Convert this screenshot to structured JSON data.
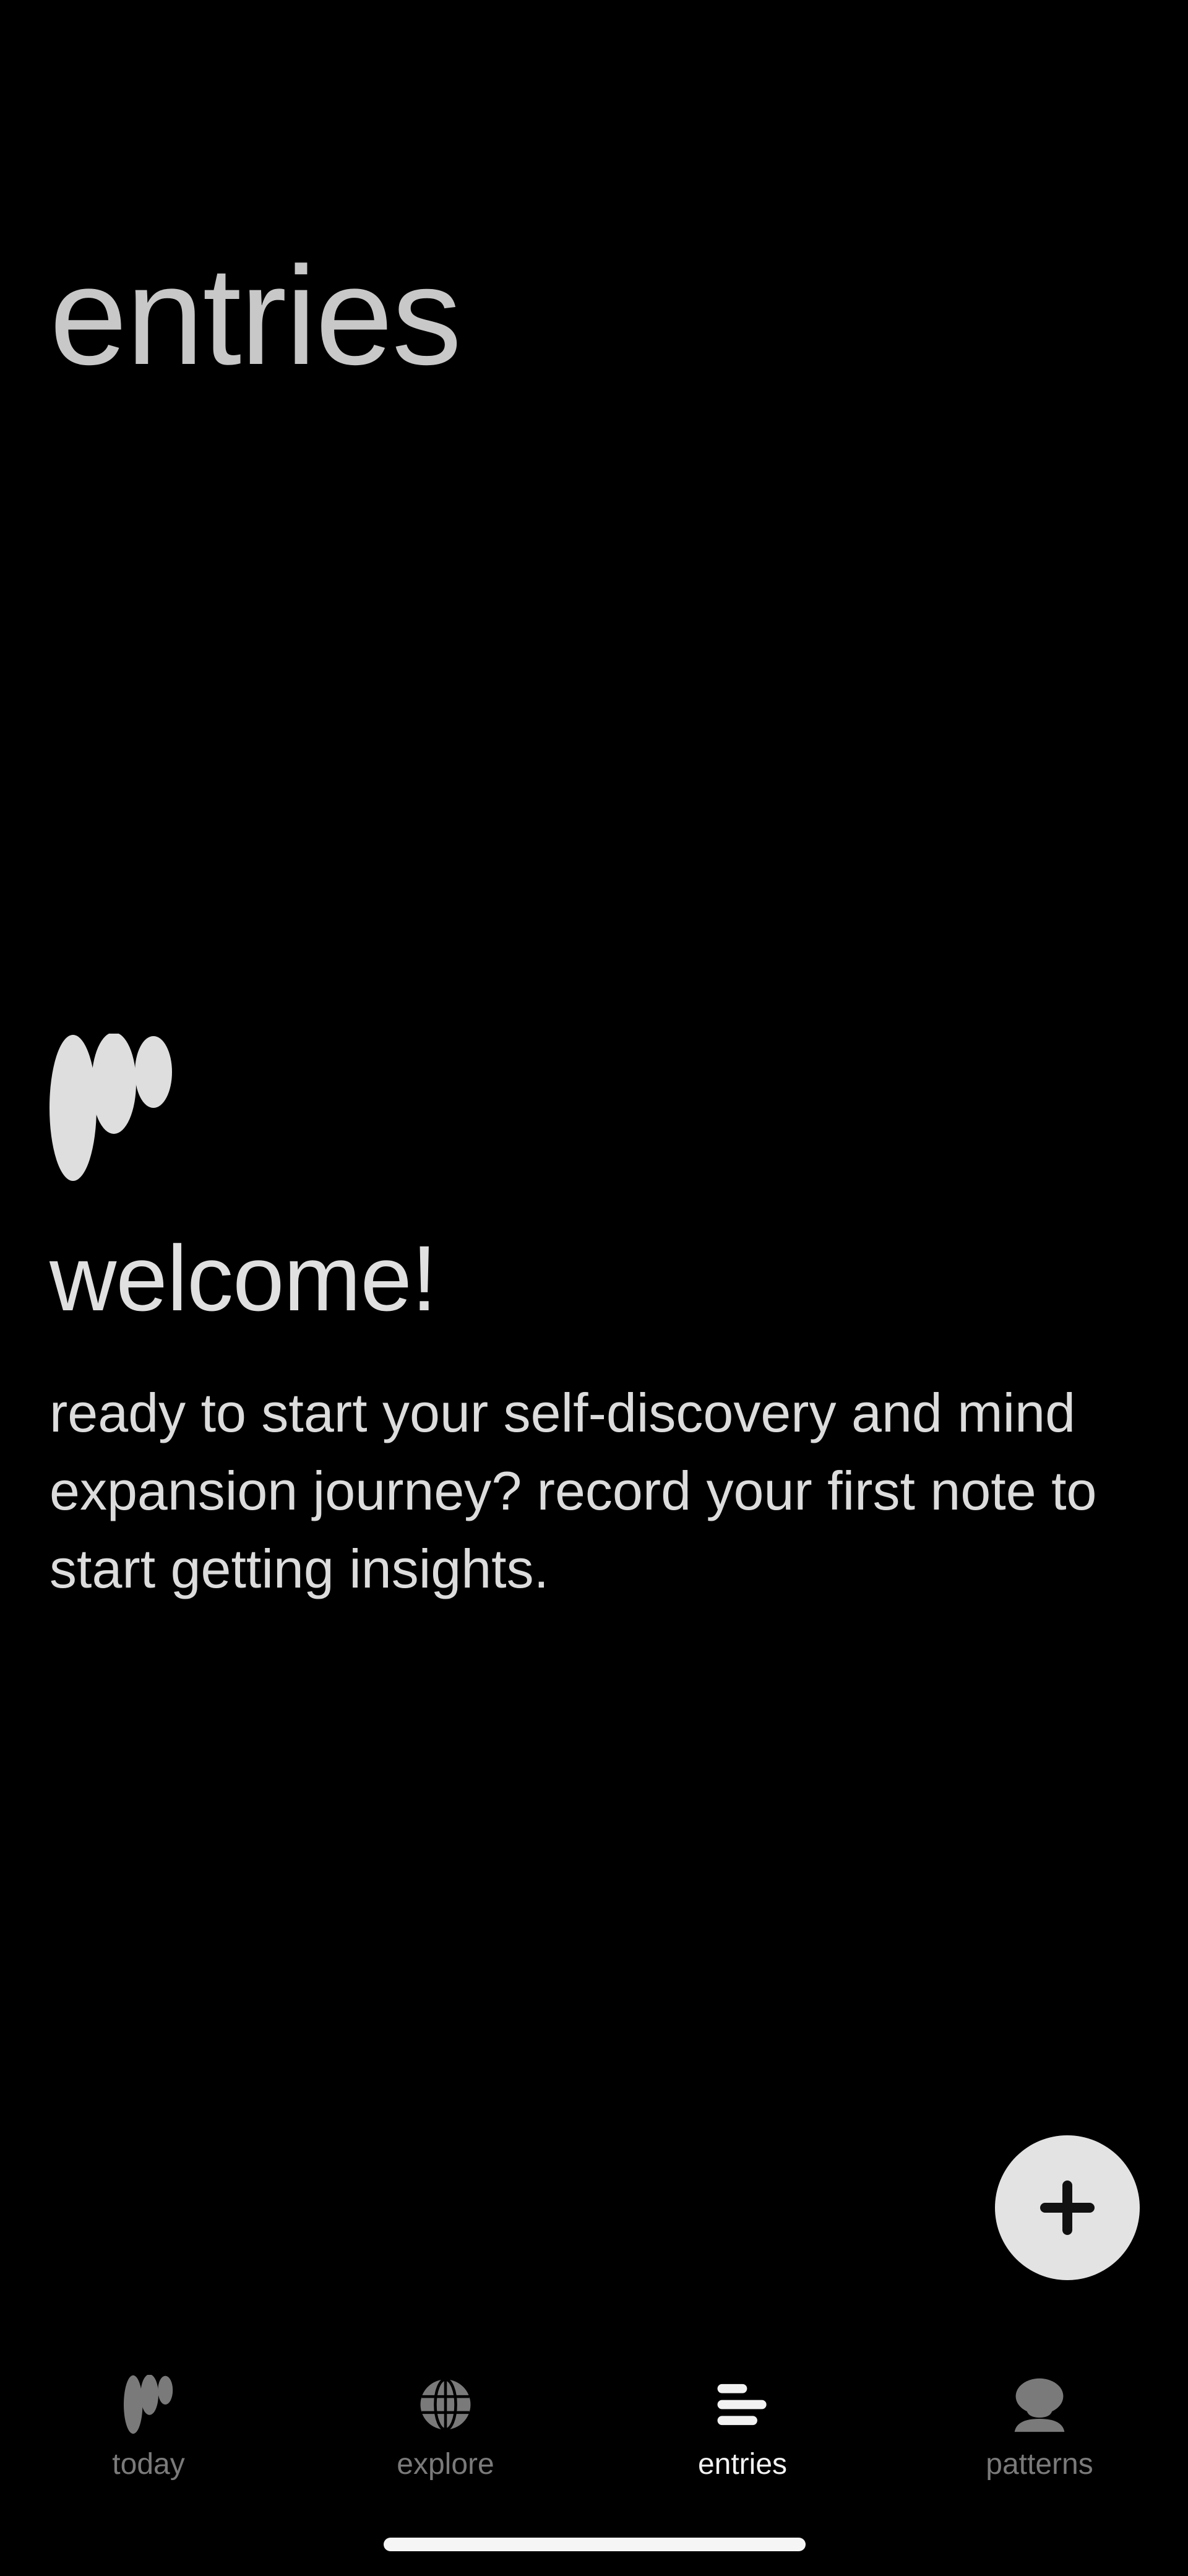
{
  "header": {
    "title": "entries"
  },
  "empty_state": {
    "logo_icon": "brand-logo-icon",
    "title": "welcome!",
    "body": "ready to start your self-discovery and mind expansion journey? record your first note to start getting insights."
  },
  "fab": {
    "icon": "plus-icon"
  },
  "tab_bar": {
    "active": "entries",
    "items": [
      {
        "label": "today",
        "icon": "brand-logo-icon"
      },
      {
        "label": "explore",
        "icon": "globe-icon"
      },
      {
        "label": "entries",
        "icon": "entries-lines-icon"
      },
      {
        "label": "patterns",
        "icon": "head-icon"
      }
    ]
  },
  "colors": {
    "background": "#000000",
    "text_primary": "#e0e0e0",
    "tab_inactive": "#7a7a7a",
    "tab_active": "#f2f2f2",
    "fab_background": "#e3e3e3"
  }
}
